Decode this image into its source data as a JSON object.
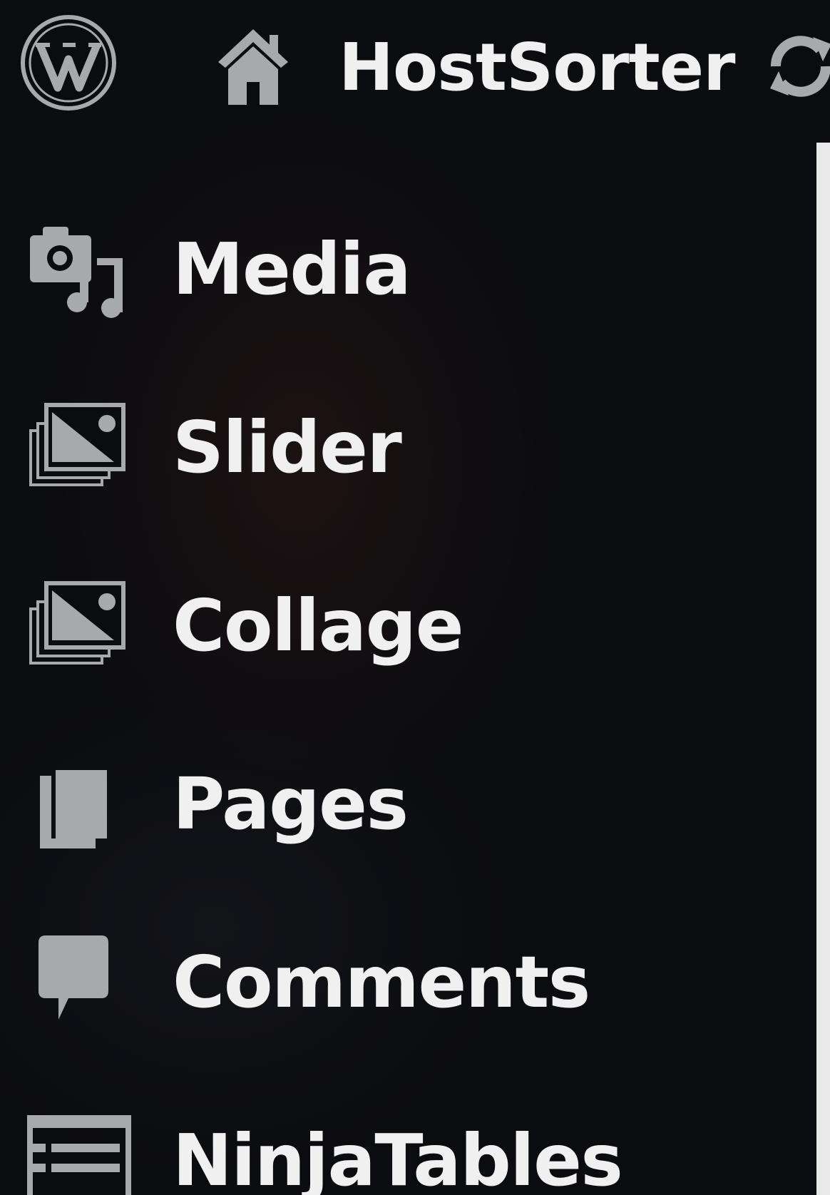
{
  "admin_bar": {
    "site_name": "HostSorter",
    "icons": [
      "wordpress-logo",
      "home-icon",
      "updates-icon"
    ]
  },
  "menu": {
    "items": [
      {
        "label": "Media",
        "icon": "media-icon"
      },
      {
        "label": "Slider",
        "icon": "gallery-icon"
      },
      {
        "label": "Collage",
        "icon": "gallery-icon"
      },
      {
        "label": "Pages",
        "icon": "pages-icon"
      },
      {
        "label": "Comments",
        "icon": "comment-icon"
      },
      {
        "label": "NinjaTables",
        "icon": "table-icon"
      }
    ]
  },
  "colors": {
    "menu_bg": "#0b0c10",
    "menu_text": "#f0f0f1",
    "icon": "#a7aaad",
    "content_bg": "#e9e9ea"
  }
}
